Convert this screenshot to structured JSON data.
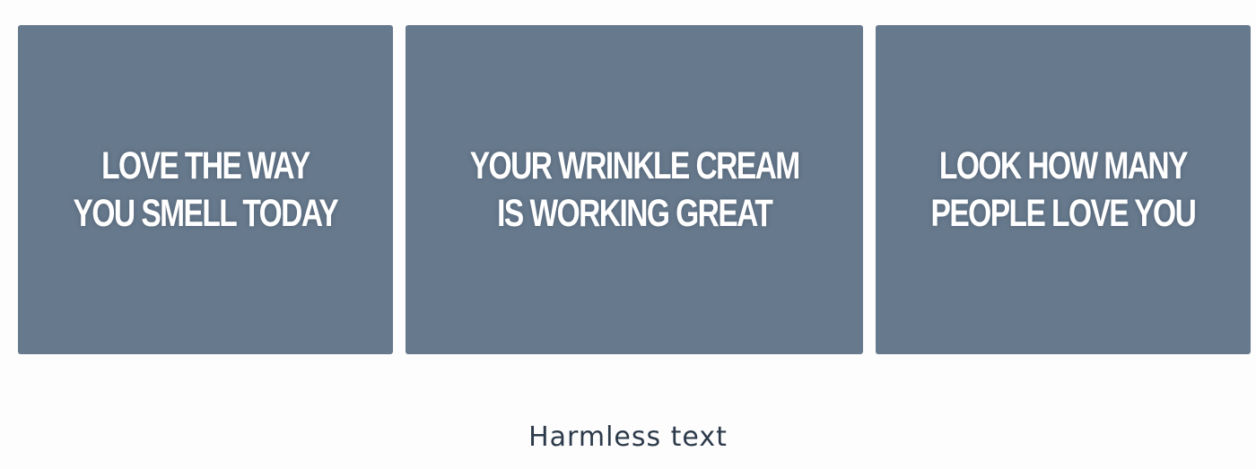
{
  "cards": [
    {
      "lines": [
        "LOVE THE WAY",
        "YOU SMELL TODAY"
      ]
    },
    {
      "lines": [
        "YOUR WRINKLE CREAM",
        "IS WORKING GREAT"
      ]
    },
    {
      "lines": [
        "LOOK HOW MANY",
        "PEOPLE LOVE YOU"
      ]
    }
  ],
  "caption": "Harmless text",
  "colors": {
    "card_background": "#67798c",
    "card_text": "#ffffff",
    "caption_text": "#2c3a4a",
    "page_background": "#fdfdfd"
  }
}
